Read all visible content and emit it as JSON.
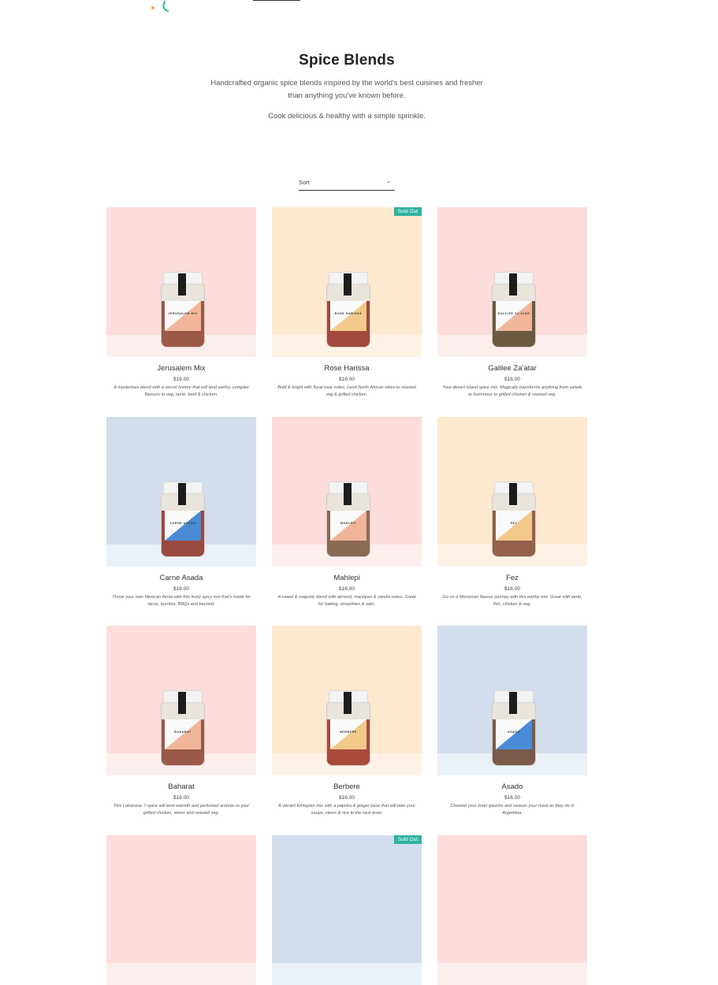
{
  "header": {
    "accent_color": "#2db39e"
  },
  "collection": {
    "title": "Spice Blends",
    "description": "Handcrafted organic spice blends inspired by the world's best cuisines and fresher than anything you've known before.",
    "tagline": "Cook delicious & healthy with a simple sprinkle."
  },
  "sort": {
    "label": "Sort",
    "chevron_icon": "chevron-down-icon"
  },
  "products": [
    {
      "name": "Jerusalem Mix",
      "price": "$16.00",
      "description": "A mysterious blend with a secret history that will lend earthy, complex flavours to veg, lamb, beef & chicken.",
      "bg": "#fddcdc",
      "floor": "#fdeeee",
      "label_color": "#f1b69a",
      "spice": "#9c5a46",
      "jar_text": "JERUSALEM MIX",
      "sold_out": false
    },
    {
      "name": "Rose Harissa",
      "price": "$16.00",
      "description": "Bold & bright with floral rose notes. Lend North African vibes to roasted veg & grilled chicken.",
      "bg": "#fde9d0",
      "floor": "#fdf2e4",
      "label_color": "#f3c98a",
      "spice": "#a0493c",
      "jar_text": "ROSE HARISSA",
      "sold_out": true,
      "badge": "Sold Out"
    },
    {
      "name": "Galilee Za'atar",
      "price": "$16.00",
      "description": "Your desert island spice mix. Magically transforms anything from salads to hummous to grilled chicken & roasted veg.",
      "bg": "#fddcdc",
      "floor": "#fdeeee",
      "label_color": "#f1b69a",
      "spice": "#6a5a40",
      "jar_text": "GALILEE ZA'ATAR",
      "sold_out": false
    },
    {
      "name": "Carne Asada",
      "price": "$16.00",
      "description": "Throw your own Mexican fiesta with this lively spicy mix that's made for tacos, burritos, BBQs and beyond.",
      "bg": "#d3deec",
      "floor": "#eaf2f7",
      "label_color": "#4a8bd6",
      "spice": "#9a4a40",
      "jar_text": "CARNE ASADA",
      "sold_out": false
    },
    {
      "name": "Mahlepi",
      "price": "$16.00",
      "description": "A sweet & majestic blend with almond, marzipan & vanilla notes. Great for baking, smoothies & oats.",
      "bg": "#fddcdc",
      "floor": "#fdeeee",
      "label_color": "#f1b69a",
      "spice": "#8a6a55",
      "jar_text": "MAHLEPI",
      "sold_out": false
    },
    {
      "name": "Fez",
      "price": "$16.00",
      "description": "Go on a Moroccan flavour journey with this earthy mix. Great with lamb, fish, chicken & veg.",
      "bg": "#fde9d0",
      "floor": "#fdf2e4",
      "label_color": "#f3c98a",
      "spice": "#94614a",
      "jar_text": "FEZ",
      "sold_out": false
    },
    {
      "name": "Baharat",
      "price": "$16.00",
      "description": "This Lebanese 7-spice will lend warmth and perfumed aromas to your grilled chicken, stews and roasted veg.",
      "bg": "#fddcdc",
      "floor": "#fdeeee",
      "label_color": "#f1b69a",
      "spice": "#9a5848",
      "jar_text": "BAHARAT",
      "sold_out": false
    },
    {
      "name": "Berbere",
      "price": "$16.00",
      "description": "A vibrant Ethiopian mix with a paprika & ginger base that will take your soups, stews & rice to the next level.",
      "bg": "#fde9d0",
      "floor": "#fdf2e4",
      "label_color": "#f3c98a",
      "spice": "#a84a3a",
      "jar_text": "BERBERE",
      "sold_out": false
    },
    {
      "name": "Asado",
      "price": "$16.00",
      "description": "Channel your inner gaucho and season your meat as they do in Argentina.",
      "bg": "#d3deec",
      "floor": "#eaf2f7",
      "label_color": "#4a8bd6",
      "spice": "#7a5a4a",
      "jar_text": "ASADO",
      "sold_out": false
    },
    {
      "name": "",
      "price": "",
      "description": "",
      "bg": "#fddcdc",
      "floor": "#fdeeee",
      "sold_out": false
    },
    {
      "name": "",
      "price": "",
      "description": "",
      "bg": "#d3deec",
      "floor": "#eaf2f7",
      "sold_out": true,
      "badge": "Sold Out"
    },
    {
      "name": "",
      "price": "",
      "description": "",
      "bg": "#fddcdc",
      "floor": "#fdeeee",
      "sold_out": false
    }
  ]
}
